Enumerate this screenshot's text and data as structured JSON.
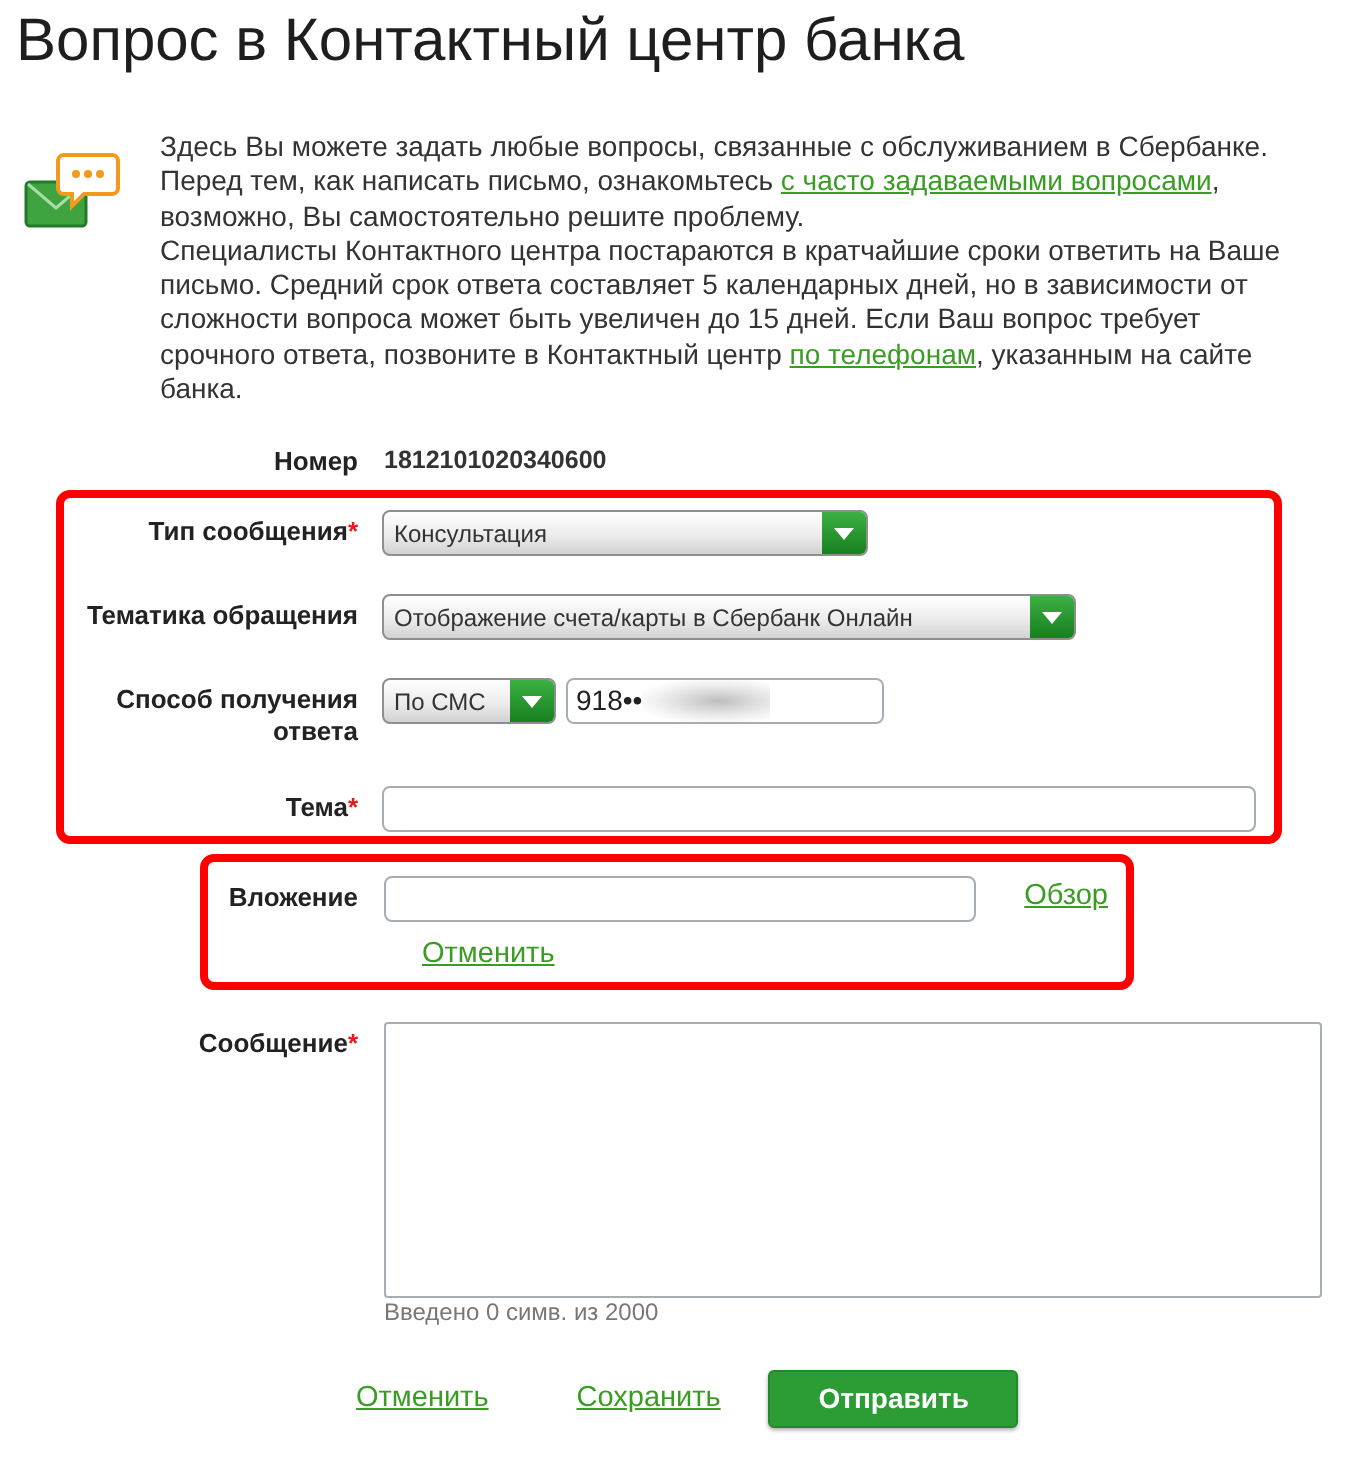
{
  "page_title": "Вопрос в Контактный центр банка",
  "intro": {
    "paragraphs": [
      {
        "segments": [
          {
            "kind": "text",
            "text": "Здесь Вы можете задать любые вопросы, связанные с обслуживанием в Сбербанке. Перед тем, как написать письмо, ознакомьтесь "
          },
          {
            "kind": "link",
            "text": "с часто задаваемыми вопросами"
          },
          {
            "kind": "text",
            "text": ", возможно, Вы самостоятельно решите проблему."
          }
        ]
      },
      {
        "segments": [
          {
            "kind": "text",
            "text": "Специалисты Контактного центра постараются в кратчайшие сроки ответить на Ваше письмо. Средний срок ответа составляет 5 календарных дней, но в зависимости от сложности вопроса может быть увеличен до 15 дней. Если Ваш вопрос требует срочного ответа, позвоните в Контактный центр "
          },
          {
            "kind": "link",
            "text": "по телефонам"
          },
          {
            "kind": "text",
            "text": ", указанным на сайте банка."
          }
        ]
      }
    ]
  },
  "request_number": {
    "label": "Номер",
    "value": "1812101020340600"
  },
  "sections": [
    {
      "highlighted": true,
      "fields": [
        {
          "kind": "select",
          "label": "Тип сообщения",
          "required_mark": "*",
          "value": "Консультация"
        },
        {
          "kind": "select",
          "label": "Тематика обращения",
          "value": "Отображение счета/карты в Сбербанк Онлайн"
        },
        {
          "kind": "select_phone",
          "label": "Способ получения ответа",
          "value": "По СМС",
          "phone": "918••",
          "phone_redacted": true
        },
        {
          "kind": "text",
          "label": "Тема",
          "required_mark": "*"
        }
      ]
    },
    {
      "highlighted": true,
      "fields": [
        {
          "kind": "file",
          "label": "Вложение",
          "browse": "Обзор",
          "cancel": "Отменить"
        }
      ]
    },
    {
      "highlighted": false,
      "fields": [
        {
          "kind": "textarea",
          "label": "Сообщение",
          "required_mark": "*",
          "counter": "Введено 0 симв. из 2000"
        }
      ]
    }
  ],
  "actions": [
    {
      "kind": "link",
      "label": "Отменить"
    },
    {
      "kind": "link",
      "label": "Сохранить"
    },
    {
      "kind": "button",
      "label": "Отправить"
    }
  ]
}
